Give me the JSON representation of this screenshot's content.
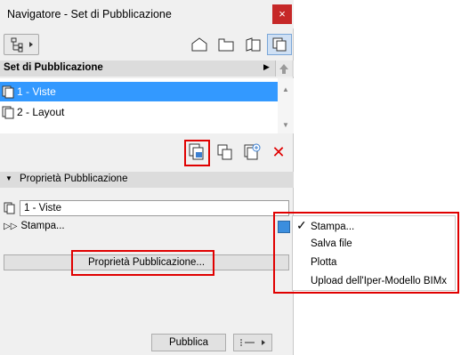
{
  "window": {
    "title": "Navigatore - Set di Pubblicazione",
    "close_symbol": "×",
    "accent_color": "#c62828"
  },
  "toolbar": {
    "left_button_icon": "project-map-icon",
    "tabs": [
      {
        "icon": "project-map-tab-icon"
      },
      {
        "icon": "view-map-tab-icon"
      },
      {
        "icon": "layout-book-tab-icon"
      },
      {
        "icon": "publisher-sets-tab-icon",
        "active": true
      }
    ]
  },
  "set_header": {
    "label": "Set di Pubblicazione"
  },
  "list": {
    "items": [
      {
        "label": "1 - Viste",
        "selected": true
      },
      {
        "label": "2 - Layout",
        "selected": false
      }
    ]
  },
  "actions": [
    {
      "icon": "new-publisher-set-icon"
    },
    {
      "icon": "duplicate-set-icon"
    },
    {
      "icon": "add-item-icon"
    },
    {
      "icon": "delete-icon",
      "symbol": "✕"
    }
  ],
  "properties": {
    "header": "Proprietà Pubblicazione",
    "set_name": "1 - Viste",
    "method_label": "Stampa...",
    "button_label": "Proprietà Pubblicazione..."
  },
  "bottom": {
    "publish_label": "Pubblica"
  },
  "menu": {
    "items": [
      {
        "label": "Stampa...",
        "checked": true
      },
      {
        "label": "Salva file",
        "checked": false
      },
      {
        "label": "Plotta",
        "checked": false
      },
      {
        "label": "Upload dell'Iper-Modello BIMx",
        "checked": false
      }
    ]
  },
  "highlight_color": "#e00000",
  "selection_color": "#3399ff"
}
